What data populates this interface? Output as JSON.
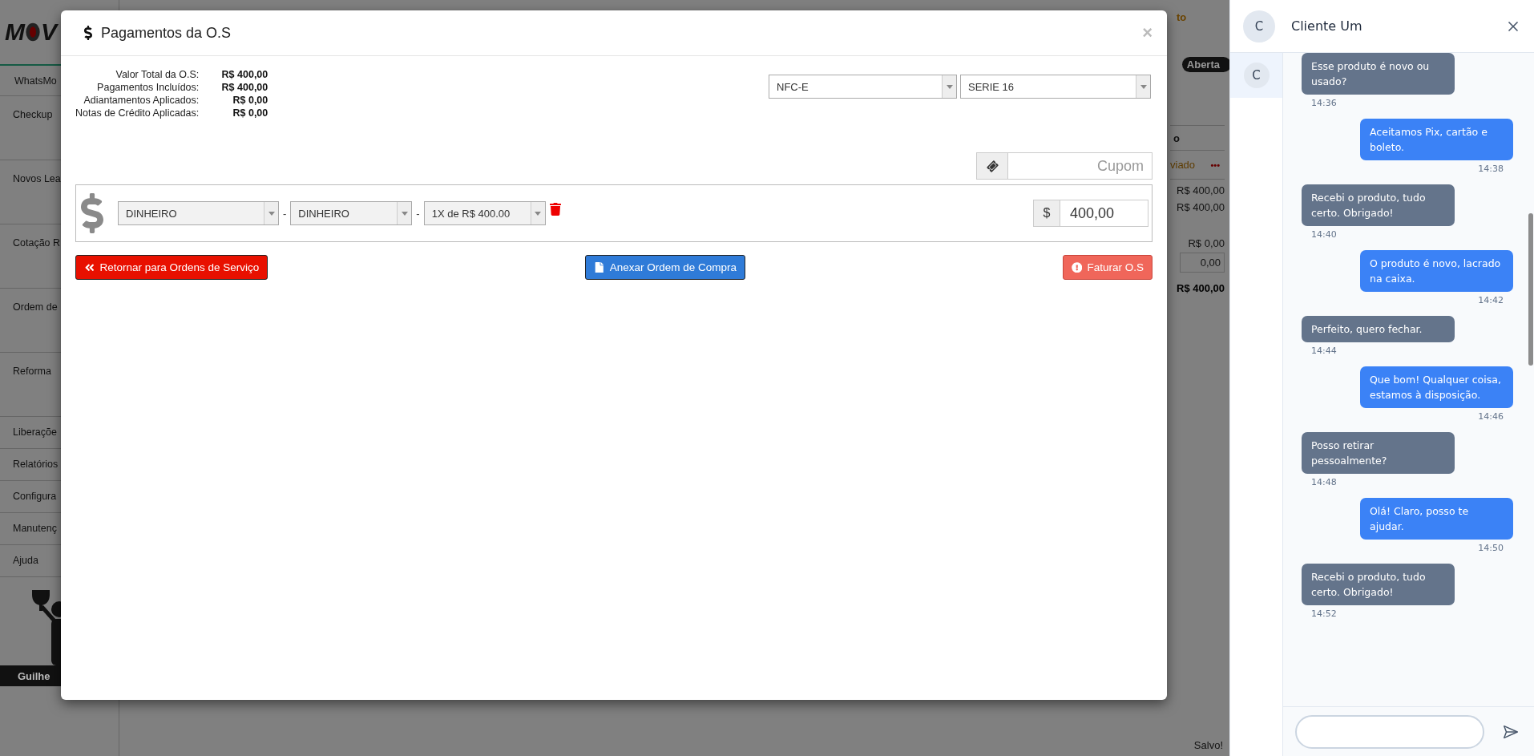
{
  "background_app": {
    "logo": {
      "left_letter": "M",
      "right_letter": "V"
    },
    "tab": "WhatsMo",
    "sidebar_items": [
      {
        "label": "Checkup",
        "kind": "tall"
      },
      {
        "label": "Novos Lea",
        "kind": "tall"
      },
      {
        "label": "Cotação R",
        "kind": "tall"
      },
      {
        "label": "Ordem de",
        "kind": "tall"
      },
      {
        "label": "Reforma",
        "kind": "tall"
      },
      {
        "label": "Liberaçõe",
        "kind": "short"
      },
      {
        "label": "Relatórios",
        "kind": "short"
      },
      {
        "label": "Configura",
        "kind": "short"
      },
      {
        "label": "Manutenç",
        "kind": "short"
      },
      {
        "label": "Ajuda",
        "kind": "short"
      }
    ],
    "user_bar": "Guilhe",
    "right_column": [
      {
        "kind": "status",
        "text": "to"
      },
      {
        "kind": "badge",
        "text": "Aberta"
      },
      {
        "kind": "column_header",
        "text": "o"
      },
      {
        "kind": "status_row",
        "text": "viado",
        "menu": "•••"
      },
      {
        "kind": "amount",
        "text": "R$ 400,00"
      },
      {
        "kind": "amount",
        "text": "R$ 400,00"
      },
      {
        "kind": "amount_gap",
        "text": "R$ 0,00"
      },
      {
        "kind": "input_cell",
        "text": "0,00"
      },
      {
        "kind": "total",
        "text": "R$ 400,00"
      }
    ],
    "save_status": "Salvo!"
  },
  "modal": {
    "title": "Pagamentos da O.S",
    "close": "×",
    "summary": [
      {
        "label": "Valor Total da O.S:",
        "value": "R$ 400,00"
      },
      {
        "label": "Pagamentos Incluídos:",
        "value": "R$ 400,00"
      },
      {
        "label": "Adiantamentos Aplicados:",
        "value": "R$ 0,00"
      },
      {
        "label": "Notas de Crédito Aplicadas:",
        "value": "R$ 0,00"
      }
    ],
    "document_type": "NFC-E",
    "series": "SERIE 16",
    "coupon": {
      "placeholder": "Cupom"
    },
    "payment": {
      "method": "DINHEIRO",
      "separator_1": "-",
      "submethod": "DINHEIRO",
      "separator_2": "-",
      "installments": "1X de R$ 400.00",
      "currency": "$",
      "amount": "400,00"
    },
    "buttons": [
      {
        "kind": "back",
        "label": "Retornar para Ordens de Serviço"
      },
      {
        "kind": "attach",
        "label": "Anexar Ordem de Compra"
      },
      {
        "kind": "invoice",
        "label": "Faturar O.S"
      }
    ]
  },
  "chat": {
    "contact": {
      "name": "Cliente Um",
      "initial": "C"
    },
    "conversations": [
      {
        "initial": "C",
        "selected": true
      }
    ],
    "messages": [
      {
        "kind": "received",
        "text": "Esse produto é novo ou usado?",
        "time": "14:36"
      },
      {
        "kind": "sent",
        "text": "Aceitamos Pix, cartão e boleto.",
        "time": "14:38"
      },
      {
        "kind": "received",
        "text": "Recebi o produto, tudo certo. Obrigado!",
        "time": "14:40"
      },
      {
        "kind": "sent",
        "text": "O produto é novo, lacrado na caixa.",
        "time": "14:42"
      },
      {
        "kind": "received",
        "text": "Perfeito, quero fechar.",
        "time": "14:44"
      },
      {
        "kind": "sent",
        "text": "Que bom! Qualquer coisa, estamos à disposição.",
        "time": "14:46"
      },
      {
        "kind": "received",
        "text": "Posso retirar pessoalmente?",
        "time": "14:48"
      },
      {
        "kind": "sent",
        "text": "Olá! Claro, posso te ajudar.",
        "time": "14:50"
      },
      {
        "kind": "received",
        "text": "Recebi o produto, tudo certo. Obrigado!",
        "time": "14:52"
      }
    ]
  }
}
